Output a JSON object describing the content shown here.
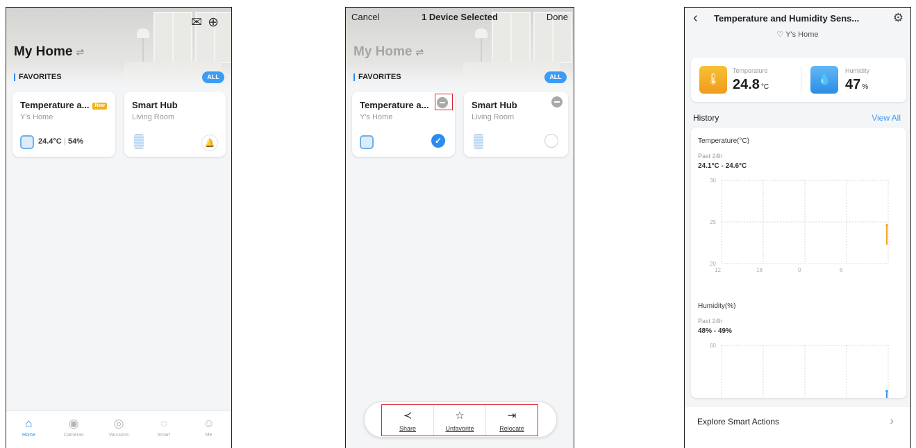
{
  "home": {
    "title": "My Home",
    "swap_glyph": "⇌",
    "favorites_label": "FAVORITES",
    "all_label": "ALL"
  },
  "devices": [
    {
      "name": "Temperature a...",
      "room": "Y's Home",
      "badge": "New",
      "reading_temp": "24.4°C",
      "reading_sep": "|",
      "reading_hum": "54%",
      "icon": "thermo-hygrometer-icon"
    },
    {
      "name": "Smart Hub",
      "room": "Living Room",
      "icon": "hub-icon"
    }
  ],
  "top_bar": {
    "mail_icon": "✉",
    "add_icon": "⊕"
  },
  "tabs": [
    {
      "label": "Home",
      "icon": "⌂",
      "active": true
    },
    {
      "label": "Cameras",
      "icon": "◉",
      "active": false
    },
    {
      "label": "Vacuums",
      "icon": "◎",
      "active": false
    },
    {
      "label": "Smart",
      "icon": "◌",
      "active": false
    },
    {
      "label": "Me",
      "icon": "☺",
      "active": false
    }
  ],
  "select_mode": {
    "cancel": "Cancel",
    "title": "1 Device Selected",
    "done": "Done",
    "check_glyph": "✓",
    "actions": [
      {
        "label": "Share",
        "icon": "≺"
      },
      {
        "label": "Unfavorite",
        "icon": "☆"
      },
      {
        "label": "Relocate",
        "icon": "⇥"
      }
    ]
  },
  "detail": {
    "back": "‹",
    "title": "Temperature and Humidity Sens...",
    "gear": "⚙",
    "location": "♡ Y's Home",
    "temperature": {
      "label": "Temperature",
      "value": "24.8",
      "unit": "°C",
      "icon": "🌡"
    },
    "humidity": {
      "label": "Humidity",
      "value": "47",
      "unit": "%",
      "icon": "💧"
    },
    "history_title": "History",
    "view_all": "View All",
    "explore": "Explore Smart Actions",
    "explore_arrow": "›"
  },
  "chart_data": [
    {
      "type": "line",
      "title": "Temperature(°C)",
      "subtitle": "Past 24h",
      "range_text": "24.1°C - 24.6°C",
      "y_ticks": [
        "30",
        "25",
        "20"
      ],
      "x_ticks": [
        "12",
        "18",
        "0",
        "6"
      ],
      "ylim": [
        20,
        30
      ],
      "series": [
        {
          "color": "#f4a72a",
          "values": [
            24.1,
            24.6
          ]
        }
      ],
      "grid": true
    },
    {
      "type": "line",
      "title": "Humidity(%)",
      "subtitle": "Past 24h",
      "range_text": "48% - 49%",
      "y_ticks": [
        "60"
      ],
      "x_ticks": [],
      "ylim": [
        40,
        60
      ],
      "series": [
        {
          "color": "#3b9cf5",
          "values": [
            48,
            49
          ]
        }
      ],
      "grid": true
    }
  ]
}
